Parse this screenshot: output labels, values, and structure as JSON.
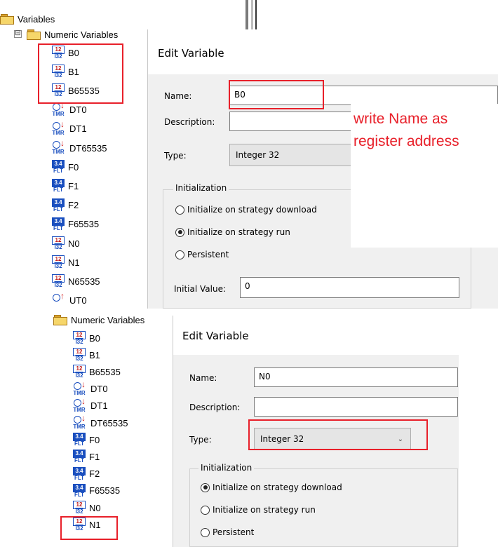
{
  "colors": {
    "highlight": "#e8202a",
    "int_icon": "#1a4fbf",
    "timer_arrow": "#d01818"
  },
  "icons": {
    "int": {
      "top": "12",
      "bottom": "I32"
    },
    "flt": {
      "top": "3.4",
      "bottom": "FLT"
    },
    "tmr": {
      "arrow": "↓",
      "bottom": "TMR"
    },
    "up_timer": {
      "arrow": "↑"
    }
  },
  "tree_top": {
    "root_label": "Variables",
    "expander": "⊟",
    "folder_label": "Numeric Variables",
    "items": [
      "B0",
      "B1",
      "B65535",
      "DT0",
      "DT1",
      "DT65535",
      "F0",
      "F1",
      "F2",
      "F65535",
      "N0",
      "N1",
      "N65535",
      "UT0"
    ]
  },
  "dialog_top": {
    "title": "Edit Variable",
    "name_label": "Name:",
    "name_value": "B0",
    "description_label": "Description:",
    "description_value": "",
    "type_label": "Type:",
    "type_value": "Integer 32",
    "init_group": "Initialization",
    "radio_download": "Initialize on strategy download",
    "radio_run": "Initialize on strategy run",
    "radio_persistent": "Persistent",
    "initial_value_label": "Initial Value:",
    "initial_value": "0"
  },
  "annotation": {
    "line1": "write  Name as",
    "line2": "register address"
  },
  "tree_bottom": {
    "folder_label": "Numeric Variables",
    "items": [
      "B0",
      "B1",
      "B65535",
      "DT0",
      "DT1",
      "DT65535",
      "F0",
      "F1",
      "F2",
      "F65535",
      "N0",
      "N1"
    ]
  },
  "dialog_bottom": {
    "title": "Edit Variable",
    "name_label": "Name:",
    "name_value": "N0",
    "description_label": "Description:",
    "description_value": "",
    "type_label": "Type:",
    "type_value": "Integer 32",
    "init_group": "Initialization",
    "radio_download": "Initialize on strategy download",
    "radio_run": "Initialize on strategy run",
    "radio_persistent": "Persistent",
    "selected_init": "download"
  }
}
